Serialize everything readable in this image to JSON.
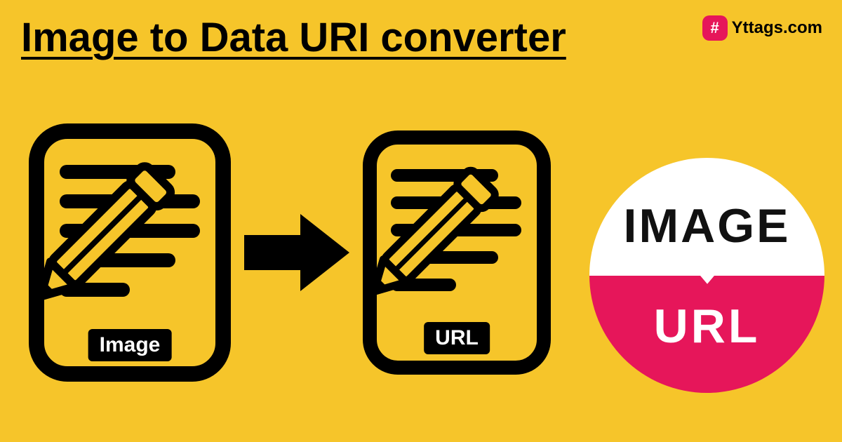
{
  "title": "Image to Data URI converter",
  "brand": {
    "name": "Yttags.com",
    "glyph": "#"
  },
  "left_doc": {
    "label": "Image"
  },
  "right_doc": {
    "label": "URL"
  },
  "circle": {
    "top_text": "IMAGE",
    "bottom_text": "URL"
  }
}
